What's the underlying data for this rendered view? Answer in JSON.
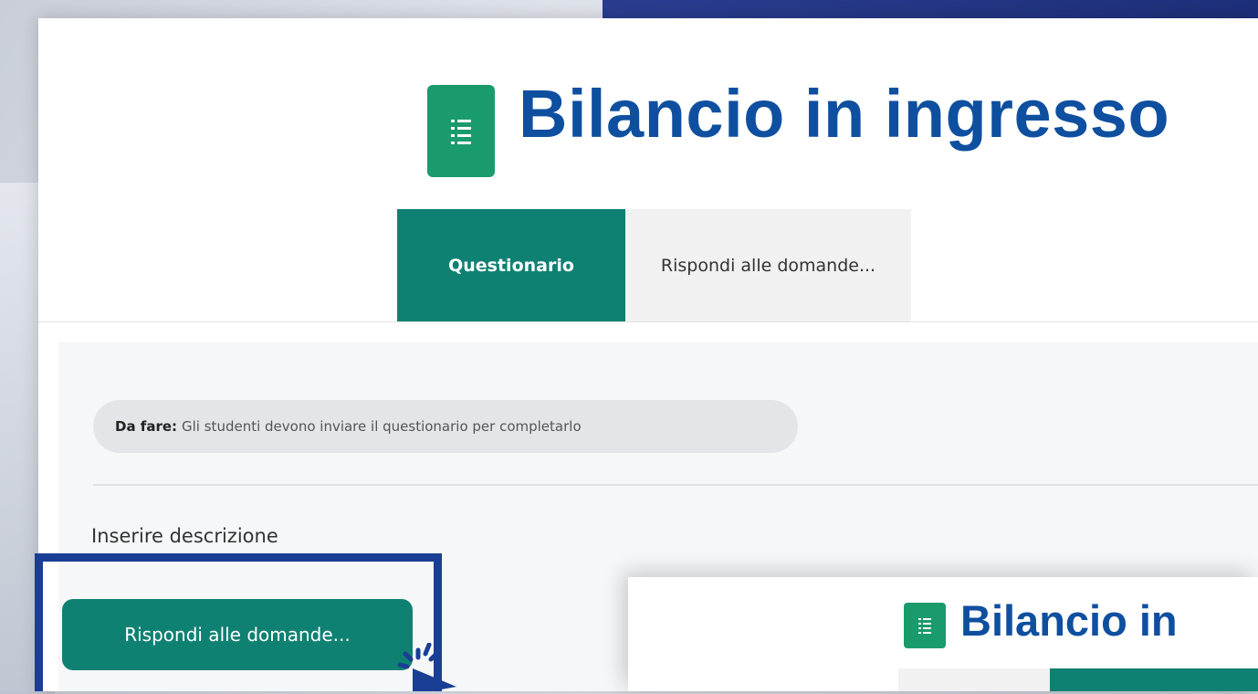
{
  "header": {
    "title": "Bilancio in ingresso",
    "icon": "questionnaire-list-icon",
    "accent": "#1a9b6c",
    "title_color": "#0f4f9f"
  },
  "tabs": [
    {
      "label": "Questionario",
      "active": true
    },
    {
      "label": "Rispondi alle domande...",
      "active": false
    }
  ],
  "completion": {
    "label": "Da fare:",
    "text": "Gli studenti devono inviare il questionario per completarlo"
  },
  "description": "Inserire descrizione",
  "action_button": {
    "label": "Rispondi alle domande...",
    "color": "#0f8173"
  },
  "overlay": {
    "title": "Bilancio in"
  },
  "colors": {
    "highlight_border": "#1a3e94",
    "tab_active": "#0f8173"
  }
}
